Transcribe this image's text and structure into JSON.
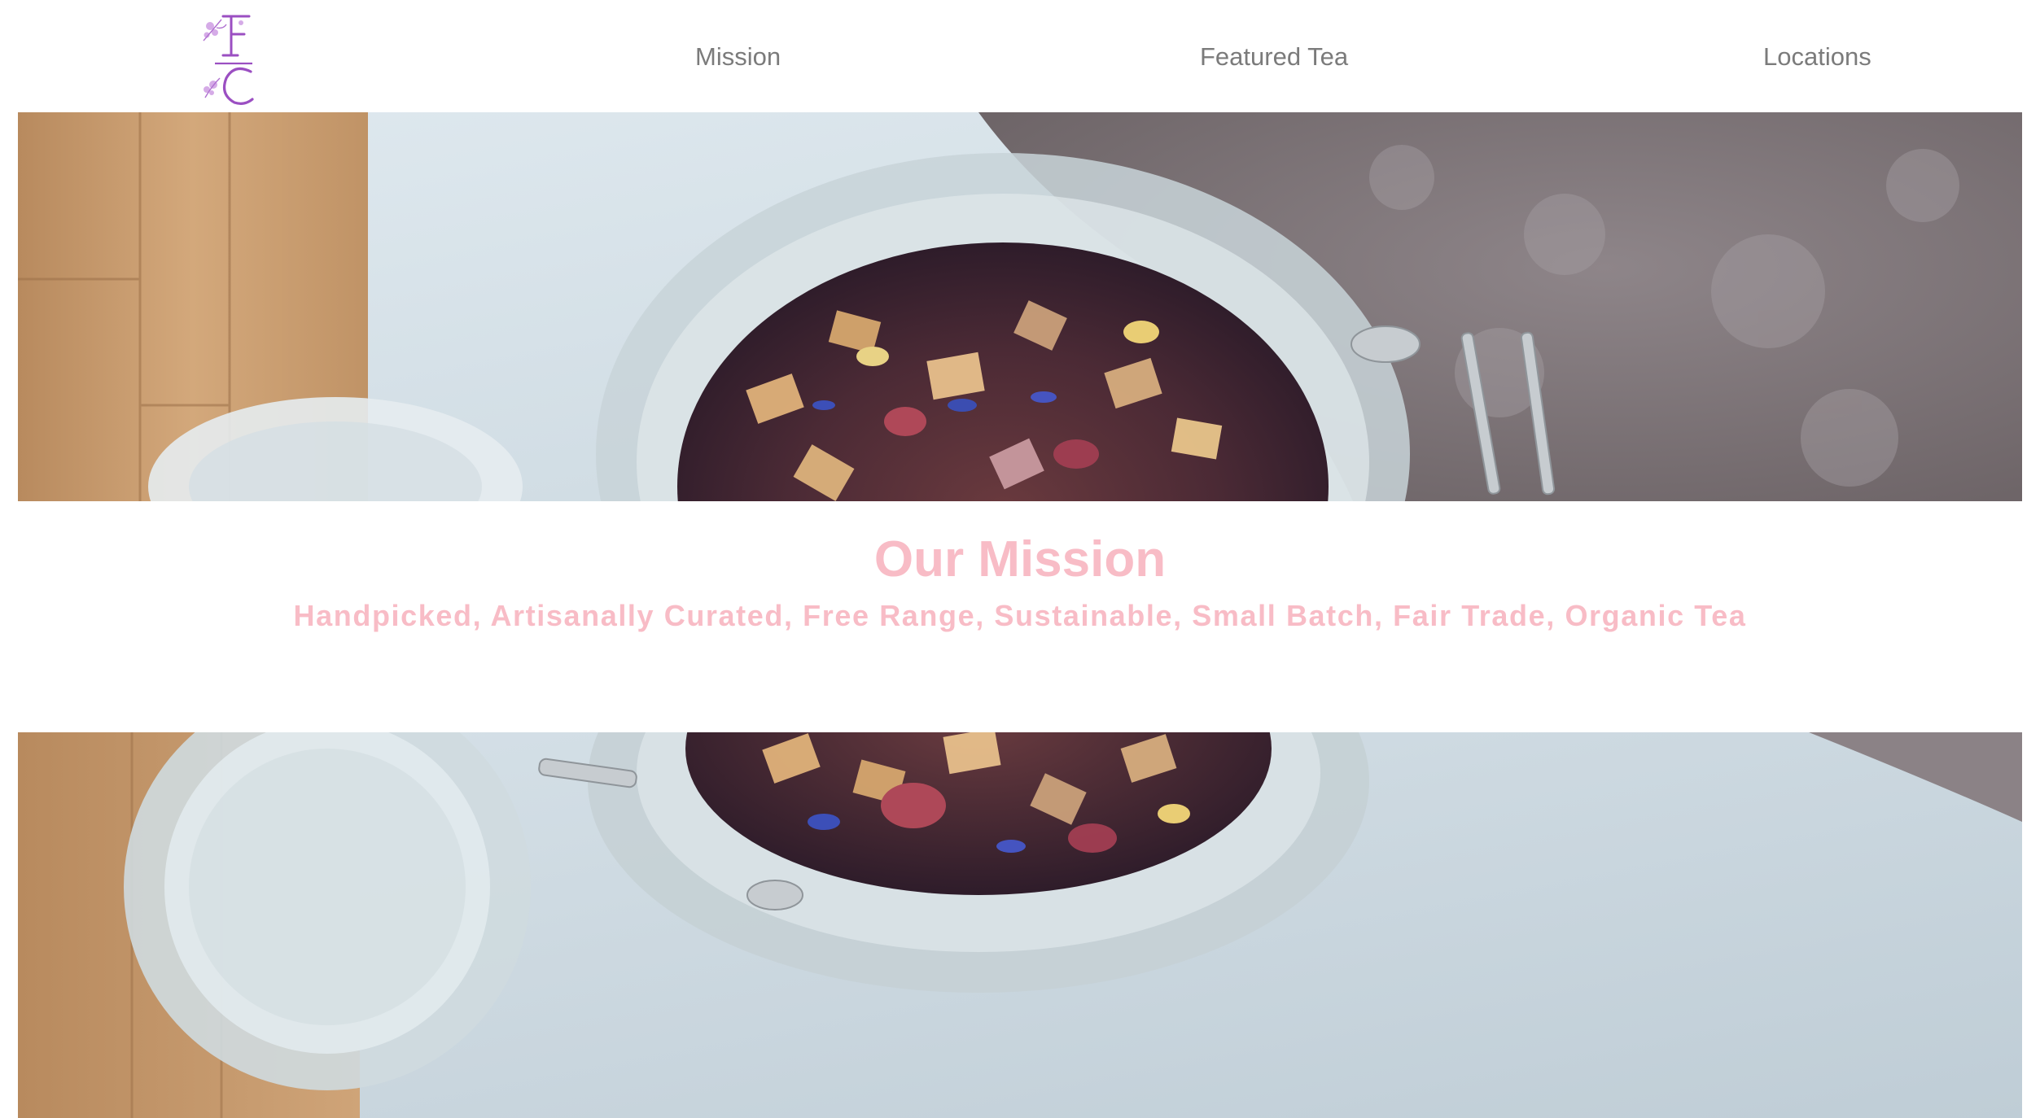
{
  "brand": {
    "logo_icon": "floral-monogram-logo",
    "logo_color": "#a35bc4"
  },
  "nav": {
    "items": [
      {
        "label": "Mission"
      },
      {
        "label": "Featured Tea"
      },
      {
        "label": "Locations"
      }
    ],
    "link_color": "#7b7b7b"
  },
  "hero_top": {
    "icon": "tea-jar-photo"
  },
  "mission": {
    "title": "Our Mission",
    "tagline": "Handpicked, Artisanally Curated, Free Range, Sustainable, Small Batch, Fair Trade, Organic Tea",
    "accent_color": "#f8bcc6"
  },
  "hero_bottom": {
    "icon": "open-tea-jar-photo"
  }
}
